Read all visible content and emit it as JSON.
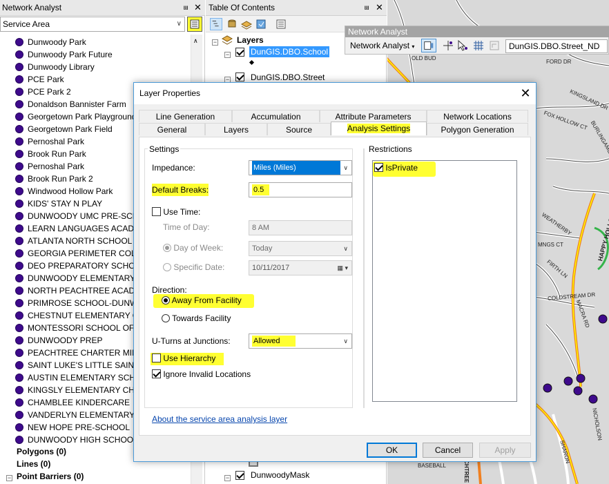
{
  "na_window": {
    "title": "Network Analyst",
    "selected_analysis": "Service Area",
    "facilities": [
      "Dunwoody Park",
      "Dunwoody Park Future",
      "Dunwoody Library",
      "PCE Park",
      "PCE Park 2",
      "Donaldson Bannister Farm",
      "Georgetown Park Playground",
      "Georgetown Park Field",
      "Pernoshal Park",
      "Brook Run Park",
      "Pernoshal Park",
      "Brook Run Park 2",
      "Windwood Hollow Park",
      "KIDS' STAY N PLAY",
      "DUNWOODY UMC PRE-SCHOOL",
      "LEARN LANGUAGES ACADEMY",
      "ATLANTA NORTH SCHOOL OF",
      "GEORGIA PERIMETER COLLEGE",
      "DEO PREPARATORY SCHOOL",
      "DUNWOODY ELEMENTARY SCHOOL",
      "NORTH PEACHTREE ACADEMY",
      "PRIMROSE SCHOOL-DUNWOODY",
      "CHESTNUT ELEMENTARY CHARTER",
      "MONTESSORI SCHOOL OF DUNWOODY",
      "DUNWOODY PREP",
      "PEACHTREE CHARTER MIDDLE",
      "SAINT LUKE'S LITTLE SAINTS",
      "AUSTIN ELEMENTARY SCHOOL",
      "KINGSLY ELEMENTARY CHARTER",
      "CHAMBLEE KINDERCARE",
      "VANDERLYN ELEMENTARY SCHOOL",
      "NEW HOPE PRE-SCHOOL",
      "DUNWOODY HIGH SCHOOL"
    ],
    "polygons": "Polygons (0)",
    "lines": "Lines (0)",
    "point_barriers": "Point Barriers (0)"
  },
  "toc": {
    "title": "Table Of Contents",
    "layers_label": "Layers",
    "layer_school": "DunGIS.DBO.School",
    "layer_street": "DunGIS.DBO.Street",
    "layer_mask": "DunwoodyMask"
  },
  "na_toolbar": {
    "title": "Network Analyst",
    "menu_label": "Network Analyst",
    "network_dataset": "DunGIS.DBO.Street_ND"
  },
  "map_labels": {
    "old_bud": "OLD BUD",
    "ford_dr": "FORD DR",
    "kingsland": "KINGSLAND DR",
    "fox_hollow": "FOX HOLLOW CT",
    "burlingame": "BURLINGAME DR",
    "happy_hollow": "HAPPY HOLLOW RD",
    "weatherby": "WEATHERBY",
    "mngs_ct": "MNGS CT",
    "firth": "FIRTH LN",
    "coldstream": "COLDSTREAM DR",
    "macra": "MACRA RD",
    "baseball": "BASEBALL",
    "peachtree": "PEACHTREE",
    "sharon": "SHARON",
    "nicholson": "NICHOLSON"
  },
  "dialog": {
    "title": "Layer Properties",
    "tabs_row1": [
      "Line Generation",
      "Accumulation",
      "Attribute Parameters",
      "Network Locations"
    ],
    "tabs_row2": [
      "General",
      "Layers",
      "Source",
      "Analysis Settings",
      "Polygon Generation"
    ],
    "settings_group": "Settings",
    "impedance_label": "Impedance:",
    "impedance_value": "Miles (Miles)",
    "default_breaks_label": "Default Breaks:",
    "default_breaks_value": "0.5",
    "use_time_label": "Use Time:",
    "time_of_day_label": "Time of Day:",
    "time_of_day_value": "8 AM",
    "day_of_week_label": "Day of Week:",
    "day_of_week_value": "Today",
    "specific_date_label": "Specific Date:",
    "specific_date_value": "10/11/2017",
    "direction_label": "Direction:",
    "direction_away": "Away From Facility",
    "direction_towards": "Towards Facility",
    "uturns_label": "U-Turns at Junctions:",
    "uturns_value": "Allowed",
    "use_hierarchy_label": "Use Hierarchy",
    "ignore_invalid_label": "Ignore Invalid Locations",
    "restrictions_group": "Restrictions",
    "restriction_item": "IsPrivate",
    "about_link": "About the service area analysis layer",
    "ok": "OK",
    "cancel": "Cancel",
    "apply": "Apply"
  },
  "colors": {
    "facility_dot": "#3e0a8c",
    "highlight": "#ffff32",
    "selection_blue": "#0078d7",
    "route_orange": "#f08020"
  }
}
